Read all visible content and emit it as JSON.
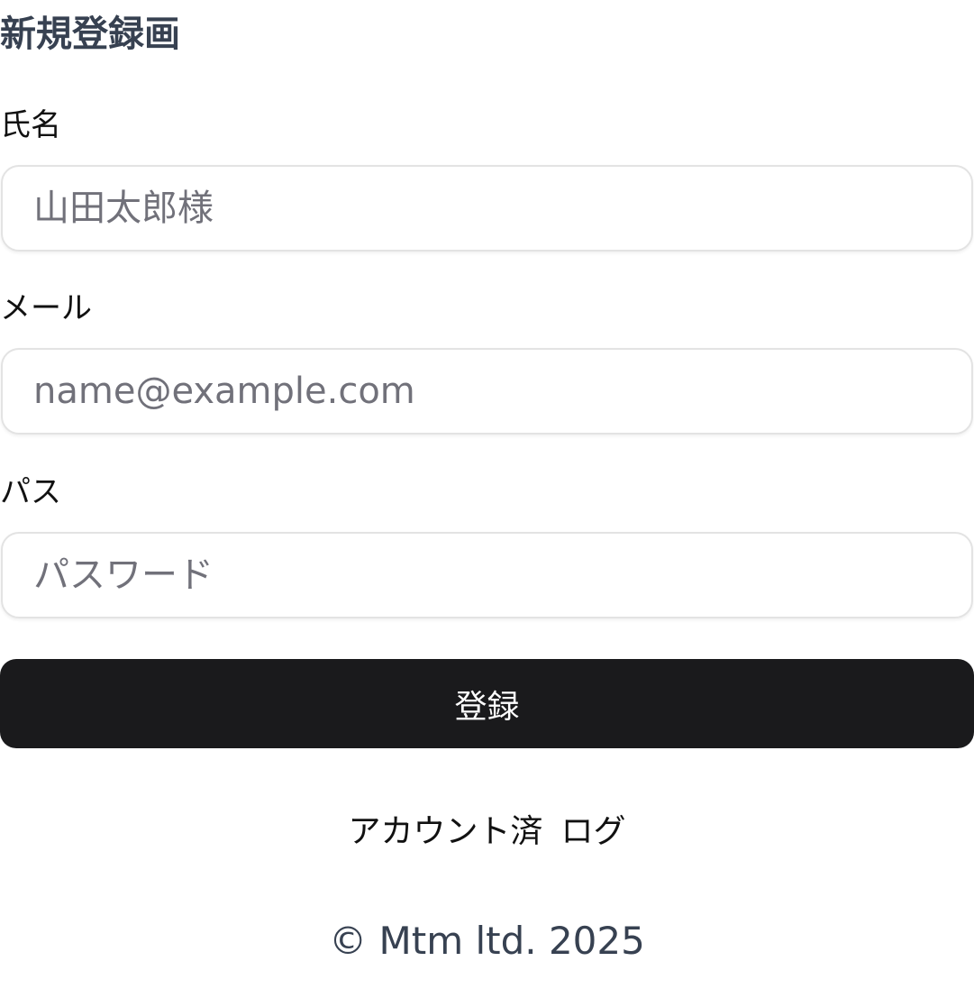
{
  "form": {
    "title": "新規登録画",
    "fields": [
      {
        "label": "氏名",
        "placeholder": "山田太郎様"
      },
      {
        "label": "メール",
        "placeholder": "name@example.com"
      },
      {
        "label": "パス",
        "placeholder": "パスワード"
      }
    ],
    "submit_label": "登録",
    "alt_prompt": "アカウント済",
    "alt_link": "ログ"
  },
  "footer": {
    "copyright": "© Mtm ltd. 2025"
  }
}
